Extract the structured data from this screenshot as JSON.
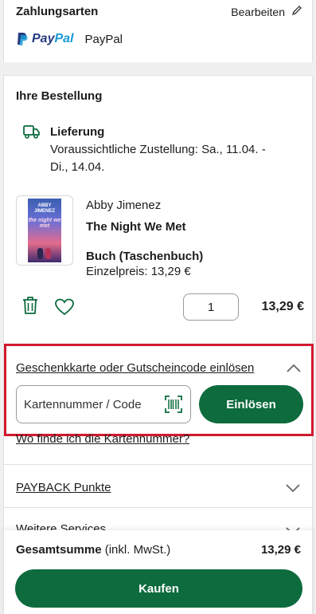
{
  "payment": {
    "title": "Zahlungsarten",
    "edit_label": "Bearbeiten",
    "method_logo_p1": "Pay",
    "method_logo_p2": "Pal",
    "method_name": "PayPal"
  },
  "order": {
    "title": "Ihre Bestellung",
    "delivery_heading": "Lieferung",
    "delivery_line1": "Voraussichtliche Zustellung: Sa., 11.04. -",
    "delivery_line2": "Di., 14.04.",
    "item": {
      "cover_author": "ABBY JIMENEZ",
      "cover_title": "the night we met",
      "author": "Abby Jimenez",
      "title": "The Night We Met",
      "format": "Buch (Taschenbuch)",
      "unit_price": "Einzelpreis: 13,29 €",
      "quantity": "1",
      "line_total": "13,29 €"
    }
  },
  "voucher": {
    "link_label": "Geschenkkarte oder Gutscheincode einlösen",
    "input_placeholder": "Kartennummer / Code",
    "redeem_label": "Einlösen",
    "where_link": "Wo finde ich die Kartennummer?"
  },
  "payback": {
    "label": "PAYBACK Punkte"
  },
  "services": {
    "label": "Weitere Services"
  },
  "footer": {
    "total_label_bold": "Gesamtsumme",
    "total_label_suffix": " (inkl. MwSt.)",
    "total_value": "13,29 €",
    "buy_label": "Kaufen"
  },
  "colors": {
    "accent_green": "#0d6b3d",
    "highlight_red": "#d1192e"
  }
}
